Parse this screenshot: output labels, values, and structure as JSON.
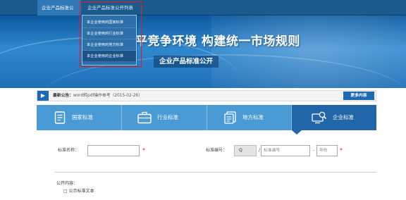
{
  "topnav": {
    "tabs": [
      {
        "label": "企业产品标准公开"
      },
      {
        "label": "企业产品标准公开列表"
      }
    ]
  },
  "dropdown": {
    "items": [
      {
        "label": "本企业使用的国家标准"
      },
      {
        "label": "本企业使用的行业标准"
      },
      {
        "label": "本企业使用的地方标准"
      },
      {
        "label": "本企业使用的企业标准"
      }
    ]
  },
  "banner": {
    "slogan": "平竞争环境 构建统一市场规则",
    "subtitle": "企业产品标准公开"
  },
  "notice": {
    "label": "最新公告：",
    "text": "word转pdf操作参考（2015-02-26）",
    "more_label": "更多内容"
  },
  "categories": [
    {
      "label": "国家标准"
    },
    {
      "label": "行业标准"
    },
    {
      "label": "地方标准"
    },
    {
      "label": "企业标准"
    }
  ],
  "form": {
    "name_label": "标准名称：",
    "number_label": "标准编号：",
    "number_prefix": "Q",
    "slash": "/",
    "number_placeholder": "标准编号",
    "dash": "-",
    "year_placeholder": "年份",
    "required_mark": "*"
  },
  "public": {
    "label": "公开内容：",
    "item": "□ 公示标准文本"
  },
  "colors": {
    "nav_dark": "#1a5a8c",
    "accent": "#1d6ab2",
    "category_bar": "#4a9ad6",
    "category_active": "#2066a8",
    "required": "#e02020"
  }
}
